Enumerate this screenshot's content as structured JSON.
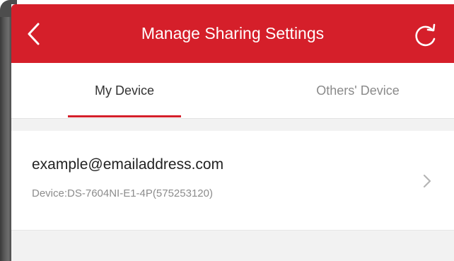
{
  "header": {
    "title": "Manage Sharing Settings",
    "back_icon": "chevron-left-icon",
    "refresh_icon": "refresh-icon"
  },
  "tabs": [
    {
      "label": "My Device",
      "active": true
    },
    {
      "label": "Others' Device",
      "active": false
    }
  ],
  "share_list": [
    {
      "email": "example@emailaddress.com",
      "device": "Device:DS-7604NI-E1-4P(575253120)"
    }
  ],
  "colors": {
    "accent": "#d51f2a",
    "background": "#f2f2f2"
  }
}
